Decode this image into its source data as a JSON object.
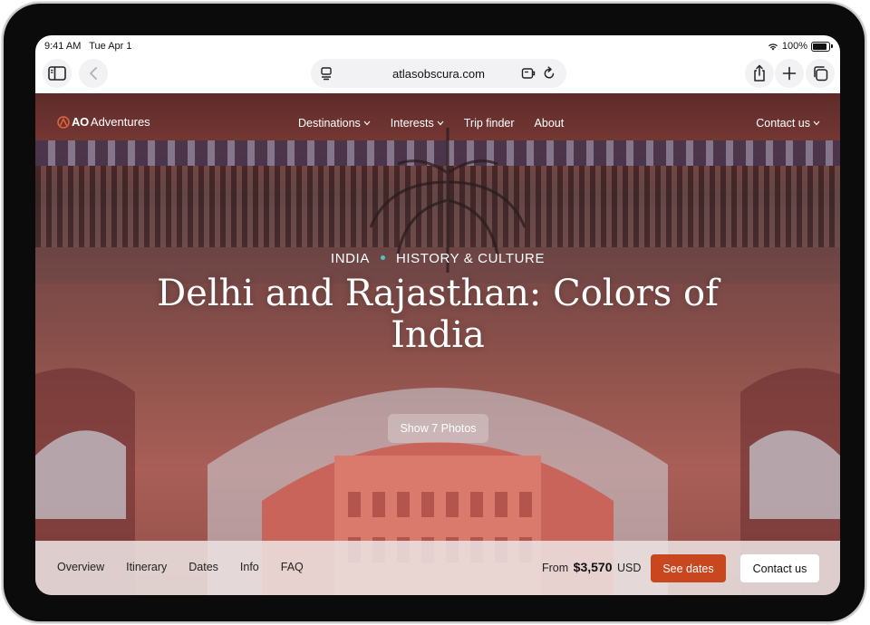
{
  "status_bar": {
    "time": "9:41 AM",
    "date": "Tue Apr 1",
    "battery": "100%"
  },
  "browser": {
    "url": "atlasobscura.com"
  },
  "site": {
    "logo_mark": "AO",
    "logo_text": "Adventures",
    "nav": [
      "Destinations",
      "Interests",
      "Trip finder",
      "About"
    ],
    "contact": "Contact us"
  },
  "hero": {
    "tag_country": "INDIA",
    "tag_category": "HISTORY & CULTURE",
    "title": "Delhi and Rajasthan: Colors of India",
    "photos_button": "Show 7 Photos"
  },
  "bottom_bar": {
    "tabs": [
      "Overview",
      "Itinerary",
      "Dates",
      "Info",
      "FAQ"
    ],
    "price_prefix": "From",
    "price": "$3,570",
    "currency": "USD",
    "see_dates": "See dates",
    "contact": "Contact us"
  },
  "colors": {
    "accent": "#c8471f",
    "tag_dot": "#4fc3c9"
  },
  "icons": [
    "wifi-icon",
    "battery-icon",
    "sidebar-icon",
    "back-icon",
    "tab-manager-icon",
    "extensions-icon",
    "reload-icon",
    "share-icon",
    "plus-icon",
    "tabs-icon",
    "chevron-down-icon",
    "logo-icon"
  ]
}
